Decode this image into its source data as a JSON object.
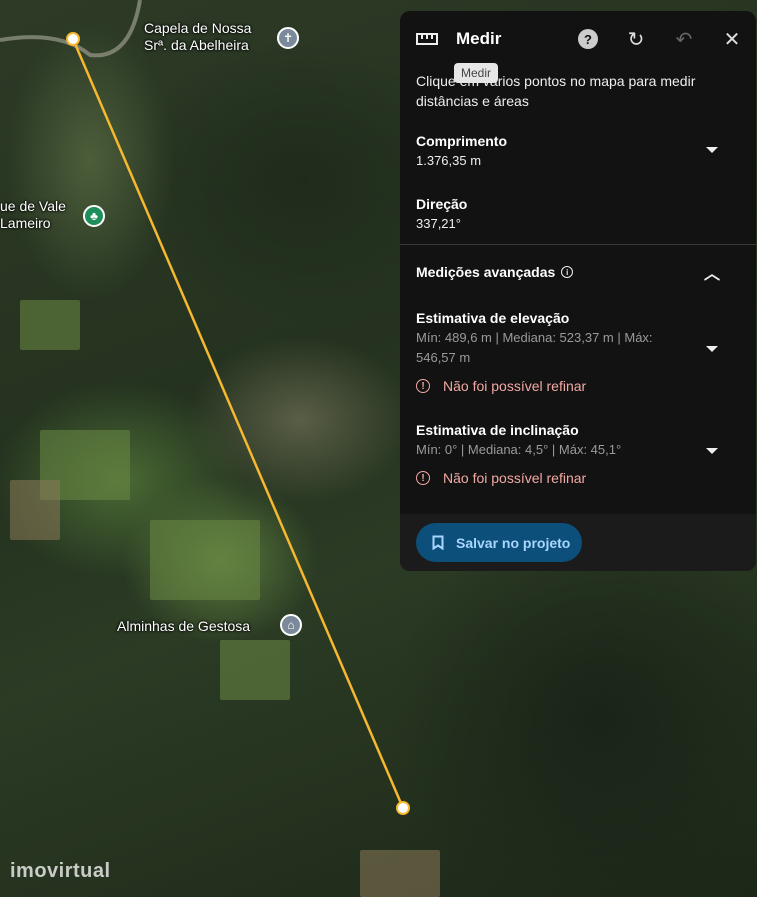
{
  "map": {
    "labels": {
      "chapel": "Capela de Nossa\nSrª. da Abelheira",
      "chapel_line1": "Capela de Nossa",
      "chapel_line2": "Srª. da Abelheira",
      "park_line1": "ue de Vale",
      "park_line2": "Lameiro",
      "alminhas": "Alminhas de Gestosa"
    },
    "watermark": "imovirtual",
    "line_color": "#f5b82e"
  },
  "panel": {
    "title": "Medir",
    "tooltip": "Medir",
    "description": "Clique em vários pontos no mapa para medir distâncias e áreas",
    "length": {
      "label": "Comprimento",
      "value": "1.376,35 m"
    },
    "direction": {
      "label": "Direção",
      "value": "337,21°"
    },
    "advanced": {
      "label": "Medições avançadas",
      "elevation": {
        "label": "Estimativa de elevação",
        "value": "Mín: 489,6 m | Mediana: 523,37 m | Máx: 546,57 m",
        "error": "Não foi possível refinar"
      },
      "slope": {
        "label": "Estimativa de inclinação",
        "value": "Mín: 0° | Mediana: 4,5° | Máx: 45,1°",
        "error": "Não foi possível refinar"
      }
    },
    "save_label": "Salvar no projeto"
  }
}
